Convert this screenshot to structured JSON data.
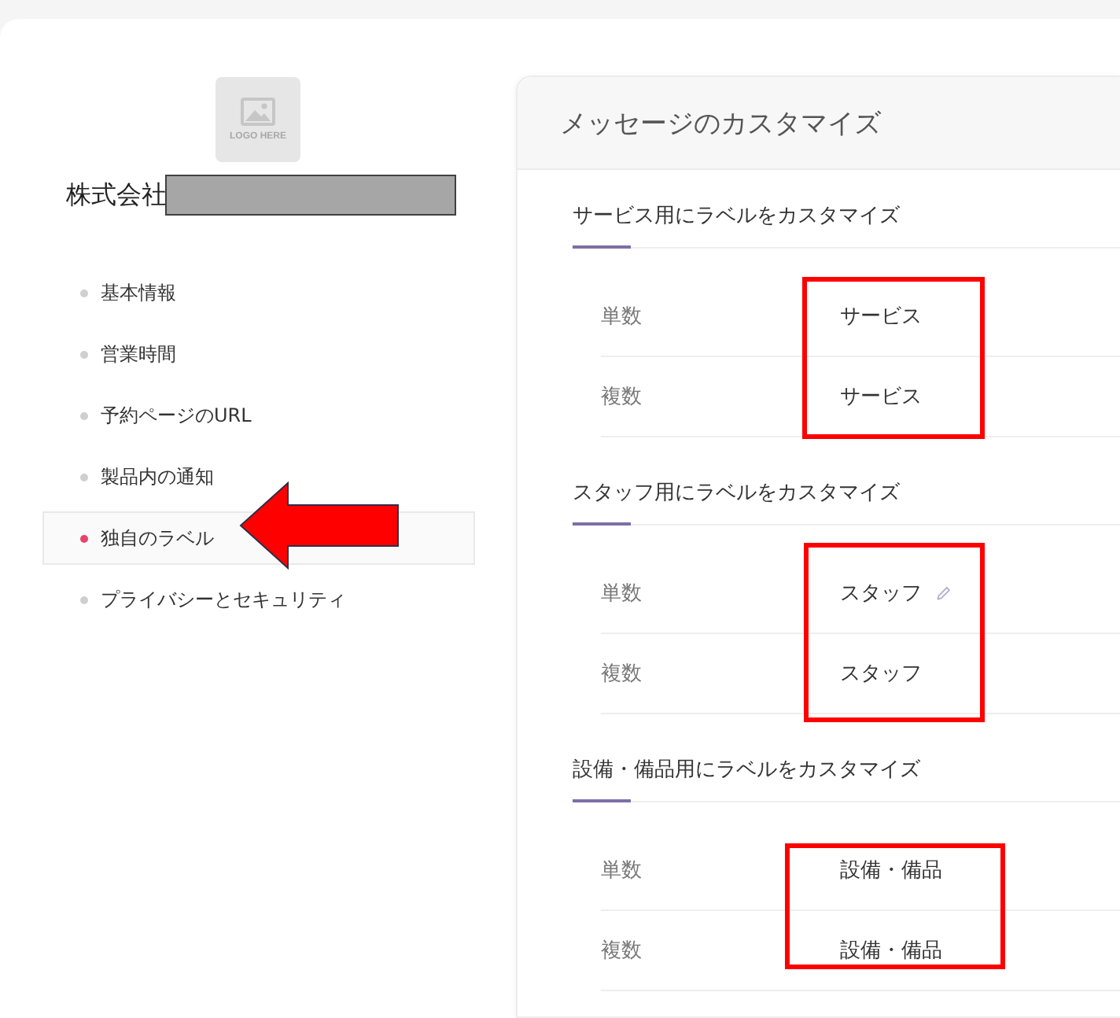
{
  "sidebar": {
    "logo": {
      "text": "LOGO HERE"
    },
    "company": {
      "name": "株式会社",
      "redacted": true
    },
    "items": [
      {
        "label": "基本情報",
        "selected": false,
        "arrow": false
      },
      {
        "label": "営業時間",
        "selected": false,
        "arrow": false
      },
      {
        "label": "予約ページのURL",
        "selected": false,
        "arrow": false
      },
      {
        "label": "製品内の通知",
        "selected": false,
        "arrow": false
      },
      {
        "label": "独自のラベル",
        "selected": true,
        "arrow": true
      },
      {
        "label": "プライバシーとセキュリティ",
        "selected": false,
        "arrow": false
      }
    ]
  },
  "panel": {
    "title": "メッセージのカスタマイズ",
    "sections": [
      {
        "title": "サービス用にラベルをカスタマイズ",
        "highlighted": true,
        "rows": [
          {
            "label": "単数",
            "value": "サービス",
            "hovered": false
          },
          {
            "label": "複数",
            "value": "サービス",
            "hovered": false
          }
        ]
      },
      {
        "title": "スタッフ用にラベルをカスタマイズ",
        "highlighted": true,
        "rows": [
          {
            "label": "単数",
            "value": "スタッフ",
            "hovered": true
          },
          {
            "label": "複数",
            "value": "スタッフ",
            "hovered": false
          }
        ]
      },
      {
        "title": "設備・備品用にラベルをカスタマイズ",
        "highlighted": true,
        "rows": [
          {
            "label": "単数",
            "value": "設備・備品",
            "hovered": false
          },
          {
            "label": "複数",
            "value": "設備・備品",
            "hovered": false
          }
        ]
      }
    ]
  }
}
